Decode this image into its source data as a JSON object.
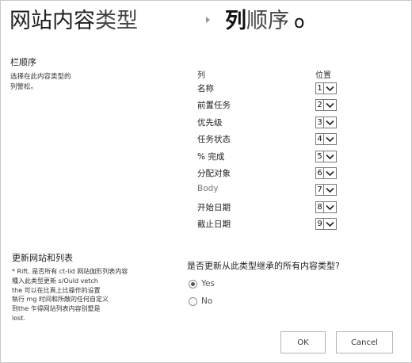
{
  "header": {
    "title_part1": "网站内容",
    "title_part2": "类型",
    "subtitle_bold": "列",
    "subtitle_regular": "顺序",
    "subtitle_suffix": "o"
  },
  "column_order": {
    "section_title": "栏顺序",
    "description_lines": [
      "选择在此内容类型的",
      "列警松。"
    ],
    "header_column": "列",
    "header_position": "位置",
    "rows": [
      {
        "label": "名称",
        "position": "1"
      },
      {
        "label": "前置任务",
        "position": "2"
      },
      {
        "label": "优先级",
        "position": "3"
      },
      {
        "label": "任务状态",
        "position": "4"
      },
      {
        "label": "% 完成",
        "position": "5"
      },
      {
        "label": "分配对象",
        "position": "6"
      },
      {
        "label": "Body",
        "position": "7"
      },
      {
        "label": "开始日期",
        "position": "8"
      },
      {
        "label": "截止日期",
        "position": "9"
      }
    ]
  },
  "update_sites": {
    "section_title": "更新网站和列表",
    "description_lines": [
      "* Rift, 是否所有 ct-lid 网站伽形列表内容",
      "種入此类型更新 s/Ould vetch",
      "the 可以在比頁上比操作的设置",
      "執行 mg 时间和所敵的任何自定义",
      "到the 乍得网站列表内容别墅是",
      "lost."
    ],
    "question": "是否更新从此类型继承的所有内容类型?",
    "options": [
      {
        "label": "Yes",
        "selected": true
      },
      {
        "label": "No",
        "selected": false
      }
    ]
  },
  "buttons": {
    "ok": "OK",
    "cancel": "Cancel"
  }
}
